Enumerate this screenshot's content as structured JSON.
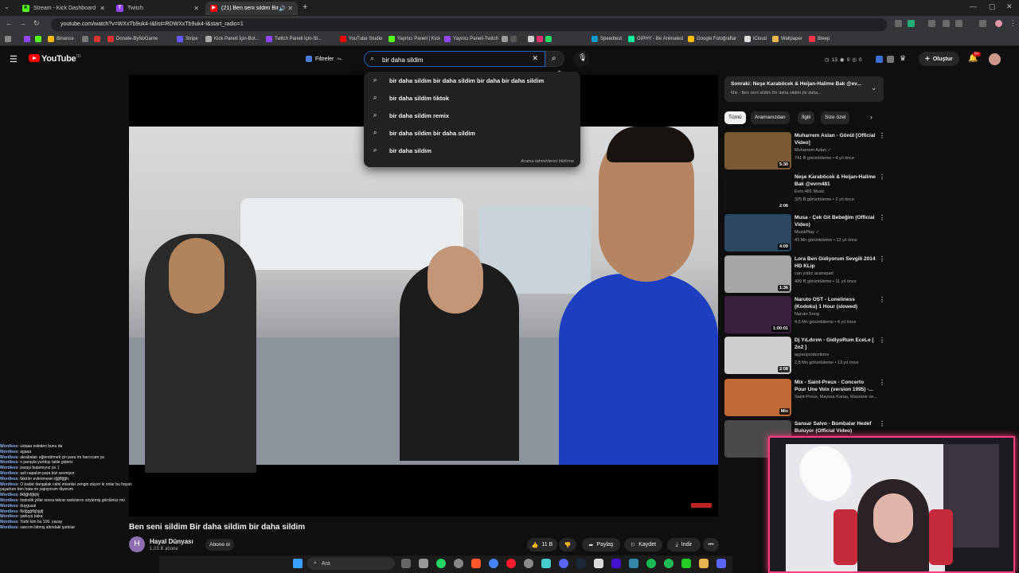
{
  "browser": {
    "tabs": [
      {
        "title": "Stream - Kick Dashboard",
        "active": false,
        "fav": "K",
        "color": "#53fc18"
      },
      {
        "title": "Twitch",
        "active": false,
        "fav": "T",
        "color": "#9146ff"
      },
      {
        "title": "(21) Ben seni sildim Bir da...",
        "active": true,
        "fav": "▶",
        "color": "#ff0000"
      }
    ],
    "new_tab": "+",
    "url": "youtube.com/watch?v=WXxTb9uk4-I&list=RDWXxTb9uk4-I&start_radio=1",
    "bookmarks": [
      {
        "label": "Binance",
        "color": "#f0b90b"
      },
      {
        "label": "",
        "color": "#777"
      },
      {
        "label": "Donate-ByNoGame",
        "color": "#d33"
      },
      {
        "label": "Stripe",
        "color": "#635bff"
      },
      {
        "label": "Kick Paneli İçin-Bot...",
        "color": "#aaa"
      },
      {
        "label": "Twitch Paneli İçin-St...",
        "color": "#9146ff"
      },
      {
        "label": "YouTube Studio",
        "color": "#ff0000"
      },
      {
        "label": "Yayıncı Paneli | Kick",
        "color": "#53fc18"
      },
      {
        "label": "Yayıncı Paneli-Twitch",
        "color": "#9146ff"
      },
      {
        "label": "Speedtest",
        "color": "#19c"
      },
      {
        "label": "GIPHY - Be Animated",
        "color": "#00ff99"
      },
      {
        "label": "Google Fotoğraflar",
        "color": "#fbbc04"
      },
      {
        "label": "iCloud",
        "color": "#ddd"
      },
      {
        "label": "Wallpaper",
        "color": "#e8b44c"
      },
      {
        "label": "Bleep",
        "color": "#e34"
      }
    ]
  },
  "youtube": {
    "logo": "YouTube",
    "logo_sup": "TR",
    "filters_label": "Filtreler",
    "search_value": "bir daha sildim",
    "suggestions": [
      "bir daha sildim bir daha sildim bir daha bir daha sildim",
      "bir daha sildim tiktok",
      "bir daha sildim remix",
      "bir daha sildim bir daha sildim",
      "bir daha sildim"
    ],
    "suggest_report": "Arama tahminlerini bildirme",
    "header_stats": {
      "a": "13",
      "b": "0",
      "c": "0"
    },
    "create_label": "Oluştur",
    "notif_count": "9+",
    "video": {
      "title": "Ben seni sildim Bir daha sildim bir daha sildim",
      "channel": "Hayal Dünyası",
      "channel_initial": "H",
      "subscribers": "1,03 B abone",
      "subscribe": "Abone ol",
      "likes": "11 B",
      "share": "Paylaş",
      "save": "Kaydet",
      "download": "İndir",
      "more": "•••"
    },
    "next_up": {
      "title": "Sonraki: Neşe Karaböcek & Heijan-Halime Bak @ev...",
      "subtitle": "Mix - Ben seni sildim Bir daha sildim bir daha..."
    },
    "chips": [
      "Tümü",
      "Aramanızdan",
      "İlgili",
      "Size özel"
    ],
    "recommendations": [
      {
        "title": "Muharrem Aslan - Gönül [Official Video]",
        "channel": "Muharrem Aslan ✓",
        "meta": "741 B görüntüleme • 4 yıl önce",
        "duration": "5:30",
        "thumb": "#7a5a34"
      },
      {
        "title": "Neşe Karaböcek & Heijan-Halime Bak @evrn481",
        "channel": "Evrn.481 Music",
        "meta": "325 B görüntüleme • 2 yıl önce",
        "duration": "2:06",
        "thumb": "#111"
      },
      {
        "title": "Musa - Çek Git Bebeğim (Official Video)",
        "channel": "MuzikPlay ✓",
        "meta": "43 Mn görüntüleme • 12 yıl önce",
        "duration": "4:09",
        "thumb": "#2b4660"
      },
      {
        "title": "Lora Ben Gidiyorum Sevgili 2014 HD KLip",
        "channel": "can yıldız acanspart",
        "meta": "499 B görüntüleme • 11 yıl önce",
        "duration": "1:36",
        "thumb": "#a6a6a6"
      },
      {
        "title": "Naruto OST - Loneliness (Kodoku) 1 Hour (slowed)",
        "channel": "Naruto Song",
        "meta": "4,5 Mn görüntüleme • 4 yıl önce",
        "duration": "1:00:01",
        "thumb": "#3b1f3f"
      },
      {
        "title": "Dj YıLdırım - GidiyoRum EceLe [ 2o2 ]",
        "channel": "ayyanproductions",
        "meta": "2,8 Mn görüntüleme • 13 yıl önce",
        "duration": "2:08",
        "thumb": "#cfcfcf"
      },
      {
        "title": "Mix - Saint-Preux - Concerto Pour Une Voix (version 1995) -...",
        "channel": "Saint-Preux, Mayssa Karaa, Maurane ve...",
        "meta": "",
        "duration": "Mix",
        "thumb": "#c06a36"
      },
      {
        "title": "Sansar Salvo - Bombalar Hedef Buluyor (Official Video)",
        "channel": "",
        "meta": "",
        "duration": "",
        "thumb": "#4a4a4a"
      }
    ]
  },
  "chat": [
    {
      "user": "Wordless",
      "msg": "ustaaa eskiden bunu da"
    },
    {
      "user": "Wordless",
      "msg": "agaaa"
    },
    {
      "user": "Wordless",
      "msg": "akrabaları eğlendirmek çin para mı harcıcam ya"
    },
    {
      "user": "Wordless",
      "msg": "o parayla yurtdışı tatile gideriz"
    },
    {
      "user": "Wordless",
      "msg": "parayı bulamıyoz ya :("
    },
    {
      "user": "Wordless",
      "msg": "asli napalım para bizi sevmiyor"
    },
    {
      "user": "Wordless",
      "msg": "fakirler evlenmesin iğğffğğh"
    },
    {
      "user": "Wordless",
      "msg": "O kadar dangalak cahil insanlar zengin oluyor ki onlar bu hayatı"
    },
    {
      "user": "",
      "msg": "yaşarken ben hata mı yapıyorum diyorum"
    },
    {
      "user": "Wordless",
      "msg": "llkfjğkfğkjhj"
    },
    {
      "user": "Wordless",
      "msg": "tripkolik yıllar sonra tekrar sarkılarını söylemiş gördünüz mü"
    },
    {
      "user": "Wordless",
      "msg": "duygusal"
    },
    {
      "user": "Wordless",
      "msg": "fkdğgğfkjhjgfj"
    },
    {
      "user": "Wordless",
      "msg": "şarkıya baka"
    },
    {
      "user": "Wordless",
      "msg": "Yarbi kim bu 100. yazay"
    },
    {
      "user": "Wordless",
      "msg": "sanırım bitmiş altındaki şarkılar"
    }
  ],
  "taskbar": {
    "search": "Ara"
  }
}
